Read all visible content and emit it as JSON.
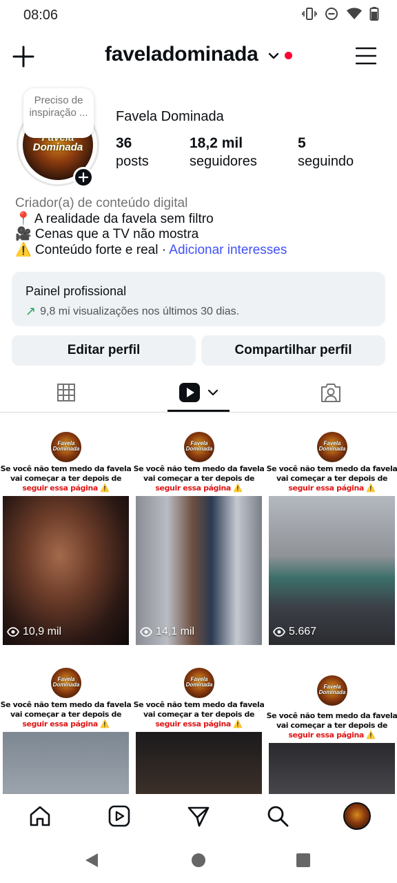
{
  "status_bar": {
    "time": "08:06"
  },
  "header": {
    "username": "faveladominada"
  },
  "profile": {
    "note": "Preciso de inspiração ...",
    "full_name": "Favela Dominada",
    "avatar_text": "Favela Dominada",
    "stats": [
      {
        "value": "36",
        "label": "posts"
      },
      {
        "value": "18,2 mil",
        "label": "seguidores"
      },
      {
        "value": "5",
        "label": "seguindo"
      }
    ],
    "category": "Criador(a) de conteúdo digital",
    "bio_lines": [
      "📍 A realidade da favela sem filtro",
      "🎥 Cenas que a TV não mostra",
      "⚠️ Conteúdo forte e real · "
    ],
    "bio_link": "Adicionar interesses"
  },
  "pro_panel": {
    "title": "Painel profissional",
    "subtitle": "9,8 mi visualizações nos últimos 30 dias."
  },
  "buttons": {
    "edit": "Editar perfil",
    "share": "Compartilhar perfil"
  },
  "tabs": [
    "grid",
    "reels",
    "tagged"
  ],
  "reels": [
    {
      "caption1": "Se você não tem medo da favela",
      "caption2": "vai começar a ter depois de",
      "caption3": "seguir essa página ⚠️",
      "views": "10,9 mil"
    },
    {
      "caption1": "Se você não tem medo da favela",
      "caption2": "vai começar a ter depois de",
      "caption3": "seguir essa página ⚠️",
      "views": "14,1 mil"
    },
    {
      "caption1": "Se você não tem medo da favela",
      "caption2": "vai começar a ter depois de",
      "caption3": "seguir essa página ⚠️",
      "views": "5.667"
    },
    {
      "caption1": "Se você não tem medo da favela",
      "caption2": "vai começar a ter depois de",
      "caption3": "seguir essa página ⚠️",
      "views": ""
    },
    {
      "caption1": "Se você não tem medo da favela",
      "caption2": "vai começar a ter depois de",
      "caption3": "seguir essa página ⚠️",
      "views": ""
    },
    {
      "caption1": "Se você não tem medo da favela",
      "caption2": "vai começar a ter depois de",
      "caption3": "seguir essa página ⚠️",
      "views": ""
    }
  ],
  "tile_badge_text": "Favela Dominada",
  "colors": {
    "link": "#4150f7",
    "notification_dot": "#ff0033",
    "growth_arrow": "#1ea35a",
    "caption_red": "#e01616"
  },
  "bottom_nav": [
    "home-icon",
    "reels-icon",
    "send-icon",
    "search-icon",
    "profile-avatar"
  ],
  "system_nav": [
    "back-icon",
    "home-circle-icon",
    "recents-icon"
  ]
}
